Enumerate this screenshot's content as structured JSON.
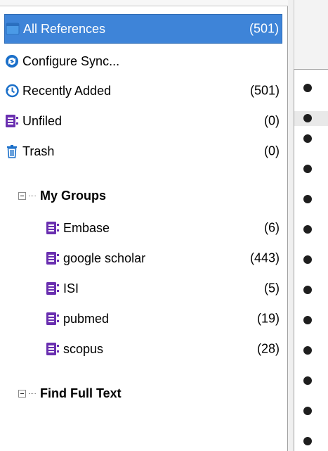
{
  "library": {
    "items": [
      {
        "label": "All References",
        "count": "(501)"
      },
      {
        "label": "Configure Sync...",
        "count": ""
      },
      {
        "label": "Recently Added",
        "count": "(501)"
      },
      {
        "label": "Unfiled",
        "count": "(0)"
      },
      {
        "label": "Trash",
        "count": "(0)"
      }
    ]
  },
  "groups": {
    "title": "My Groups",
    "items": [
      {
        "label": "Embase",
        "count": "(6)"
      },
      {
        "label": "google scholar",
        "count": "(443)"
      },
      {
        "label": "ISI",
        "count": "(5)"
      },
      {
        "label": "pubmed",
        "count": "(19)"
      },
      {
        "label": "scopus",
        "count": "(28)"
      }
    ]
  },
  "find_full_text": {
    "title": "Find Full Text"
  },
  "colors": {
    "selection": "#3e84d8",
    "group_icon": "#6a2fb0",
    "accent_blue": "#1a6fc9"
  }
}
